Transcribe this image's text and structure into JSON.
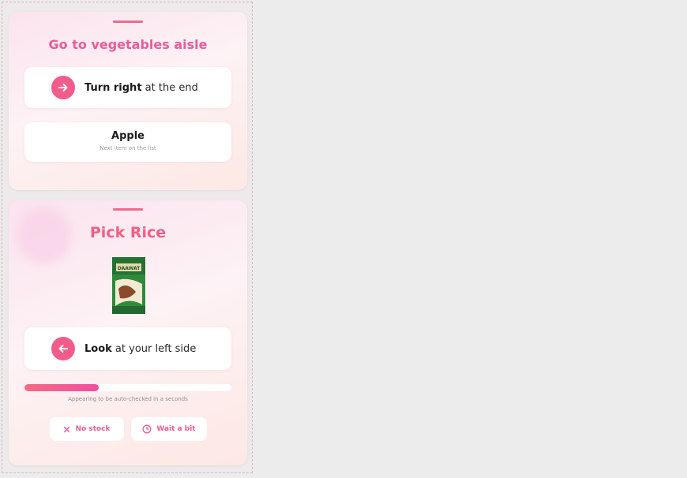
{
  "card1": {
    "title": "Go to vegetables aisle",
    "direction": {
      "icon": "arrow-right-icon",
      "bold": "Turn right",
      "rest": " at the end"
    },
    "item": {
      "name": "Apple",
      "subtitle": "Next item on the list"
    }
  },
  "card2": {
    "title": "Pick Rice",
    "product": {
      "brand": "DAAWAT"
    },
    "direction": {
      "icon": "arrow-left-icon",
      "bold": "Look",
      "rest": " at your left side"
    },
    "progress": {
      "value": 0.36,
      "caption": "Appearing to be auto-checked in a seconds"
    },
    "actions": {
      "no_stock": "No stock",
      "wait_list": "Wait a bit"
    }
  },
  "colors": {
    "accent": "#f25c8b",
    "title_pink": "#ec5b98",
    "background": "#ececec"
  }
}
